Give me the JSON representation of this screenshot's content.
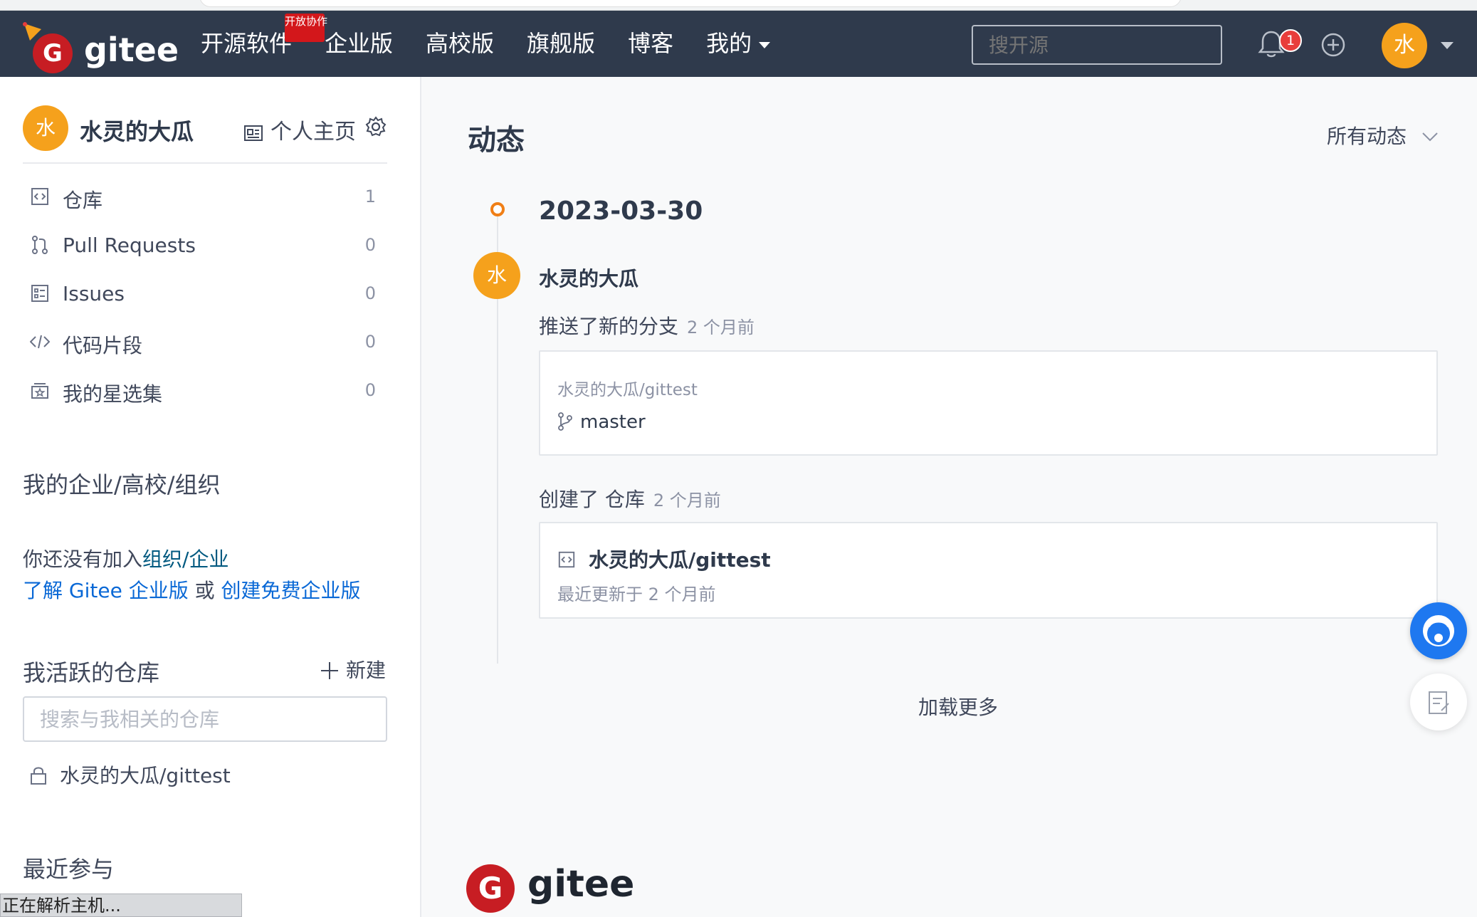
{
  "navbar": {
    "logo_text": "gitee",
    "logo_letter": "G",
    "links": [
      {
        "label": "开源软件",
        "badge": "开放协作"
      },
      {
        "label": "企业版"
      },
      {
        "label": "高校版"
      },
      {
        "label": "旗舰版"
      },
      {
        "label": "博客"
      },
      {
        "label": "我的"
      }
    ],
    "search_placeholder": "搜开源",
    "notification_count": "1",
    "avatar_letter": "水"
  },
  "sidebar": {
    "avatar_letter": "水",
    "username": "水灵的大瓜",
    "homepage_label": "个人主页",
    "menu": [
      {
        "label": "仓库",
        "count": "1",
        "icon": "repo-icon"
      },
      {
        "label": "Pull Requests",
        "count": "0",
        "icon": "pull-request-icon"
      },
      {
        "label": "Issues",
        "count": "0",
        "icon": "issues-icon"
      },
      {
        "label": "代码片段",
        "count": "0",
        "icon": "code-icon"
      },
      {
        "label": "我的星选集",
        "count": "0",
        "icon": "star-collection-icon"
      }
    ],
    "org_section_title": "我的企业/高校/组织",
    "org_text_prefix": "你还没有加入",
    "org_link1": "组织",
    "org_sep": "/",
    "org_link2": "企业",
    "learn_link": "了解 Gitee 企业版",
    "or_text": "或",
    "create_link": "创建免费企业版",
    "active_repos_title": "我活跃的仓库",
    "new_label": "新建",
    "repo_search_placeholder": "搜索与我相关的仓库",
    "repos": [
      "水灵的大瓜/gittest"
    ],
    "recent_title": "最近参与"
  },
  "status_bar": "正在解析主机...",
  "main": {
    "title": "动态",
    "filter_label": "所有动态",
    "date": "2023-03-30",
    "avatar_letter": "水",
    "user": "水灵的大瓜",
    "event1": {
      "action": "推送了新的分支",
      "time": "2 个月前",
      "repo": "水灵的大瓜/gittest",
      "branch": "master"
    },
    "event2": {
      "action": "创建了 仓库",
      "time": "2 个月前",
      "repo": "水灵的大瓜/gittest",
      "updated": "最近更新于 2 个月前"
    },
    "load_more": "加载更多"
  },
  "footer": {
    "logo_text": "gitee",
    "logo_letter": "G"
  },
  "colors": {
    "navbar_bg": "#2f3a4c",
    "accent_orange": "#f5a11c",
    "brand_red": "#c71d23",
    "link_blue": "#005980"
  }
}
